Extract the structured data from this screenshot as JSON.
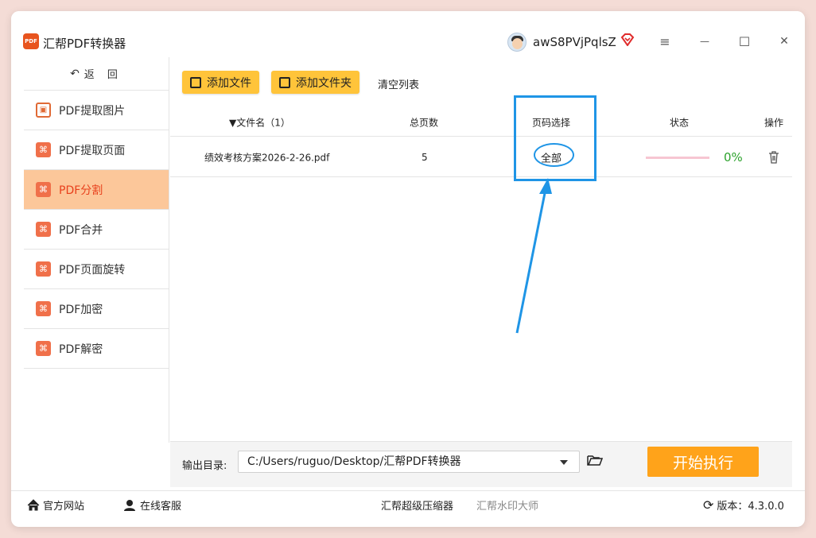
{
  "app": {
    "logo_text": "PDF",
    "title": "汇帮PDF转换器",
    "username": "awS8PVjPqlsZ"
  },
  "window_controls": {
    "menu": "≡",
    "minimize": "—",
    "maximize": "☐",
    "close": "✕"
  },
  "sidebar": {
    "back_label": "返 回",
    "items": [
      {
        "label": "PDF提取图片",
        "icon": "image-icon"
      },
      {
        "label": "PDF提取页面",
        "icon": "pdf-icon"
      },
      {
        "label": "PDF分割",
        "icon": "pdf-icon",
        "active": true
      },
      {
        "label": "PDF合并",
        "icon": "pdf-icon"
      },
      {
        "label": "PDF页面旋转",
        "icon": "pdf-icon"
      },
      {
        "label": "PDF加密",
        "icon": "pdf-icon"
      },
      {
        "label": "PDF解密",
        "icon": "pdf-icon"
      }
    ]
  },
  "toolbar": {
    "add_file": "添加文件",
    "add_folder": "添加文件夹",
    "clear_list": "清空列表"
  },
  "table": {
    "columns": {
      "filename": "▼文件名（1）",
      "total_pages": "总页数",
      "page_select": "页码选择",
      "status": "状态",
      "action": "操作"
    },
    "rows": [
      {
        "filename": "绩效考核方案2026-2-26.pdf",
        "total_pages": "5",
        "page_select": "全部",
        "progress_pct": "0%"
      }
    ]
  },
  "output": {
    "label": "输出目录:",
    "path": "C:/Users/ruguo/Desktop/汇帮PDF转换器",
    "start_button": "开始执行"
  },
  "footer": {
    "website": "官方网站",
    "support": "在线客服",
    "product1": "汇帮超级压缩器",
    "product2": "汇帮水印大师",
    "version": "版本：4.3.0.0"
  },
  "colors": {
    "accent_orange": "#ffa31a",
    "button_yellow": "#ffc43a",
    "active_bg": "#fcc79a",
    "active_text": "#e8401c",
    "annotation_blue": "#1f95e6",
    "progress_green": "#2ea32e"
  }
}
